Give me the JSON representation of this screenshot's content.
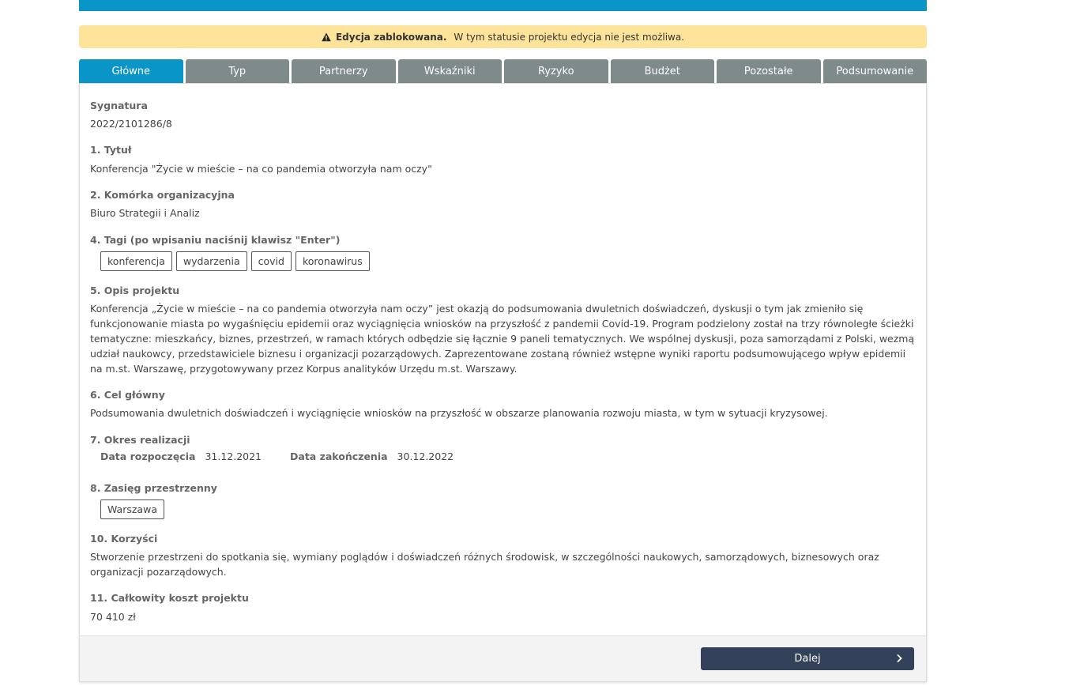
{
  "alert": {
    "title": "Edycja zablokowana.",
    "message": "W tym statusie projektu edycja nie jest możliwa.",
    "icon": "warning-icon"
  },
  "tabs": [
    {
      "label": "Główne",
      "active": true
    },
    {
      "label": "Typ"
    },
    {
      "label": "Partnerzy"
    },
    {
      "label": "Wskaźniki"
    },
    {
      "label": "Ryzyko"
    },
    {
      "label": "Budżet"
    },
    {
      "label": "Pozostałe"
    },
    {
      "label": "Podsumowanie"
    }
  ],
  "fields": {
    "signature_label": "Sygnatura",
    "signature_value": "2022/2101286/8",
    "title_label": "1. Tytuł",
    "title_value": "Konferencja \"Życie w mieście – na co pandemia otworzyła nam oczy\"",
    "unit_label": "2. Komórka organizacyjna",
    "unit_value": "Biuro Strategii i Analiz",
    "tags_label": "4. Tagi (po wpisaniu naciśnij klawisz \"Enter\")",
    "tags": [
      "konferencja",
      "wydarzenia",
      "covid",
      "koronawirus"
    ],
    "description_label": "5. Opis projektu",
    "description_lines": [
      "Konferencja „Życie w mieście – na co pandemia otworzyła nam oczy” jest okazją do podsumowania dwuletnich doświadczeń, dyskusji o tym jak zmieniło się",
      "funkcjonowanie miasta po wygaśnięciu epidemii oraz wyciągnięcia wniosków na przyszłość z pandemii Covid-19. Program podzielony został na trzy równoległe ścieżki",
      "tematyczne: mieszkańcy, biznes, przestrzeń, w ramach których odbędzie się łącznie 9 paneli tematycznych. We wspólnej dyskusji, poza samorządami z Polski, wezmą",
      "udział naukowcy, przedstawiciele biznesu i organizacji pozarządowych. Zaprezentowane zostaną również wstępne wyniki raportu podsumowującego wpływ epidemii",
      "na m.st. Warszawę, przygotowywany przez Korpus analityków Urzędu m.st. Warszawy."
    ],
    "goal_label": "6. Cel główny",
    "goal_value": "Podsumowania dwuletnich doświadczeń i wyciągnięcie wniosków na przyszłość w obszarze planowania rozwoju miasta, w tym w sytuacji kryzysowej.",
    "period_label": "7. Okres realizacji",
    "start_label": "Data rozpoczęcia",
    "start_value": "31.12.2021",
    "end_label": "Data zakończenia",
    "end_value": "30.12.2022",
    "range_label": "8. Zasięg przestrzenny",
    "range_tags": [
      "Warszawa"
    ],
    "benefits_label": "10. Korzyści",
    "benefits_lines": [
      "Stworzenie przestrzeni do spotkania się, wymiany poglądów i doświadczeń różnych środowisk, w szczególności naukowych, samorządowych, biznesowych oraz",
      "organizacji pozarządowych."
    ],
    "cost_label": "11. Całkowity koszt projektu",
    "cost_value": "70 410 zł"
  },
  "footer": {
    "next_label": "Dalej"
  }
}
